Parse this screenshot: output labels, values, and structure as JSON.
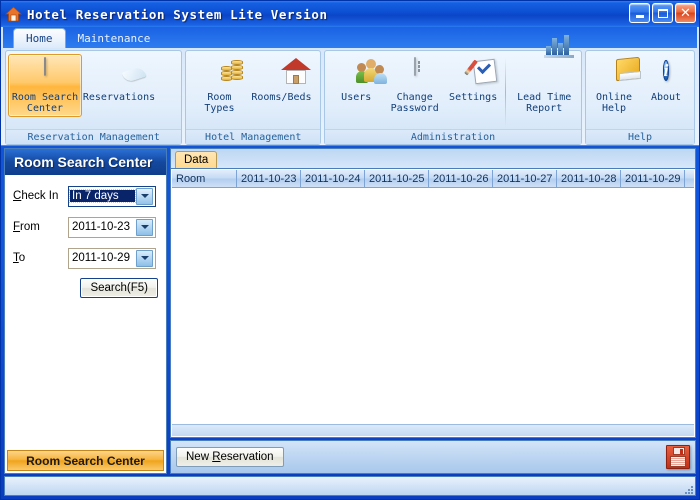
{
  "window": {
    "title": "Hotel Reservation System Lite Version",
    "icon": "house-icon",
    "minimize_label": "Minimize",
    "maximize_label": "Maximize",
    "close_label": "Close"
  },
  "tabs": [
    {
      "label": "Home",
      "active": true
    },
    {
      "label": "Maintenance",
      "active": false
    }
  ],
  "ribbon": {
    "groups": [
      {
        "label": "Reservation Management",
        "items": [
          {
            "label": "Room Search\nCenter",
            "icon": "calendar-icon",
            "active": true
          },
          {
            "label": "Reservations",
            "icon": "globe-envelope-icon",
            "active": false
          }
        ]
      },
      {
        "label": "Hotel Management",
        "items": [
          {
            "label": "Room\nTypes",
            "icon": "coins-icon",
            "active": false
          },
          {
            "label": "Rooms/Beds",
            "icon": "house-icon",
            "active": false
          }
        ]
      },
      {
        "label": "Administration",
        "items": [
          {
            "label": "Users",
            "icon": "users-icon",
            "active": false
          },
          {
            "label": "Change\nPassword",
            "icon": "password-field-icon",
            "active": false
          },
          {
            "label": "Settings",
            "icon": "checklist-pen-icon",
            "active": false
          },
          {
            "label": "Lead Time\nReport",
            "icon": "bar-chart-icon",
            "active": false
          }
        ]
      },
      {
        "label": "Help",
        "items": [
          {
            "label": "Online\nHelp",
            "icon": "book-icon",
            "active": false
          },
          {
            "label": "About",
            "icon": "info-icon",
            "active": false
          }
        ]
      }
    ]
  },
  "sidebar": {
    "header": "Room Search Center",
    "fields": [
      {
        "label": "Check In",
        "accesskey": "C",
        "value": "In 7 days",
        "focused": true
      },
      {
        "label": "From",
        "accesskey": "F",
        "value": "2011-10-23",
        "focused": false
      },
      {
        "label": "To",
        "accesskey": "T",
        "value": "2011-10-29",
        "focused": false
      }
    ],
    "search_button": "Search(F5)",
    "nav_button": "Room Search Center"
  },
  "main": {
    "tabs": [
      {
        "label": "Data",
        "active": true
      }
    ],
    "grid": {
      "columns": [
        "Room",
        "2011-10-23",
        "2011-10-24",
        "2011-10-25",
        "2011-10-26",
        "2011-10-27",
        "2011-10-28",
        "2011-10-29"
      ],
      "rows": []
    },
    "action_bar": {
      "new_reservation_label": "New Reservation",
      "new_reservation_accesskey": "R",
      "save_icon": "floppy-save-icon"
    }
  },
  "status_bar": {
    "text": ""
  },
  "colors": {
    "title_blue": "#0d4fd4",
    "accent_orange": "#f0a41c",
    "sidebar_header": "#14499f",
    "grid_header": "#c4daf4",
    "close_red": "#d9431b"
  }
}
